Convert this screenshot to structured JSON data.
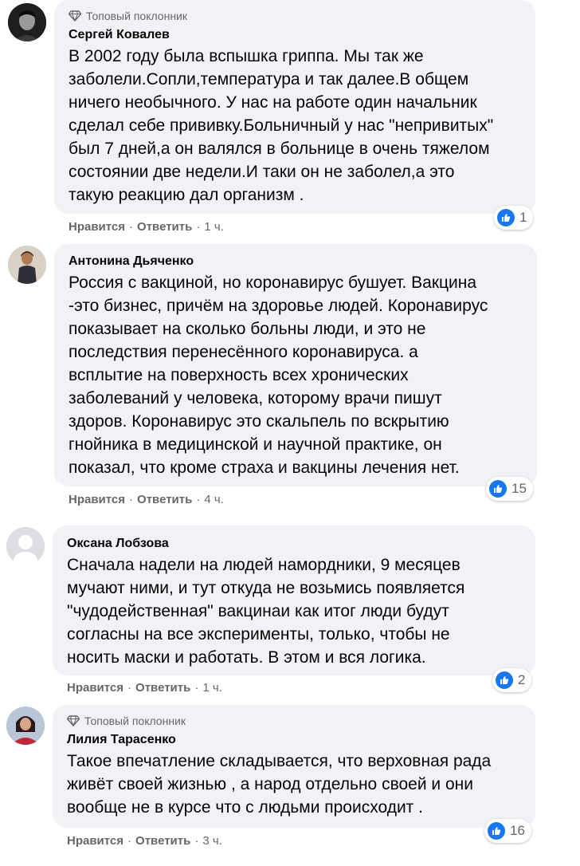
{
  "comments": [
    {
      "badge": "Топовый поклонник",
      "author": "Сергей Ковалев",
      "text": "В 2002 году была вспышка гриппа. Мы так же\nзаболели.Сопли,температура и так далее.В общем\nничего необычного. У нас на работе один начальник\nсделал себе прививку.Больничный у нас \"непривитых\"\nбыл 7 дней,а он валялся в больнице в очень тяжелом\nсостоянии две недели.И таки он не заболел,а это\nтакую реакцию дал организм .",
      "likes": "1",
      "like_label": "Нравится",
      "reply_label": "Ответить",
      "time": "1 ч."
    },
    {
      "author": "Антонина Дьяченко",
      "text": "Россия с вакциной, но коронавирус бушует. Вакцина\n-это бизнес, причём на здоровье людей. Коронавирус\nпоказывает на сколько больны люди, и это не\nпоследствия перенесённого коронавируса. а\nвсплытие на поверхность всех хронических\nзаболеваний у человека, которому врачи пишут\nздоров. Коронавирус это скальпель по вскрытию\nгнойника в медицинской и научной практике, он\nпоказал, что кроме страха и вакцины лечения нет.",
      "likes": "15",
      "like_label": "Нравится",
      "reply_label": "Ответить",
      "time": "4 ч."
    },
    {
      "author": "Оксана Лобзова",
      "text": "Сначала надели на людей намордники, 9 месяцев\nмучают ними, и тут откуда не возьмись появляется\n\"чудодейственная\" вакцинаи как итог люди будут\nсогласны на все эксперименты, только, чтобы не\nносить маски и работать. В этом и вся логика.",
      "likes": "2",
      "like_label": "Нравится",
      "reply_label": "Ответить",
      "time": "1 ч."
    },
    {
      "badge": "Топовый поклонник",
      "author": "Лилия Тарасенко",
      "text": "Такое впечатление складывается, что верховная рада\nживёт своей жизнью , а народ отдельно своей и они\nвообще не в курсе что с людьми происходит .",
      "likes": "16",
      "like_label": "Нравится",
      "reply_label": "Ответить",
      "time": "3 ч."
    }
  ],
  "icons": {
    "badge": "diamond-icon",
    "reaction": "thumbs-up-icon",
    "avatar_placeholder": "default-avatar-icon"
  },
  "colors": {
    "bubble": "#f0f2f5",
    "like_blue": "#1877f2",
    "secondary_text": "#65676b"
  }
}
